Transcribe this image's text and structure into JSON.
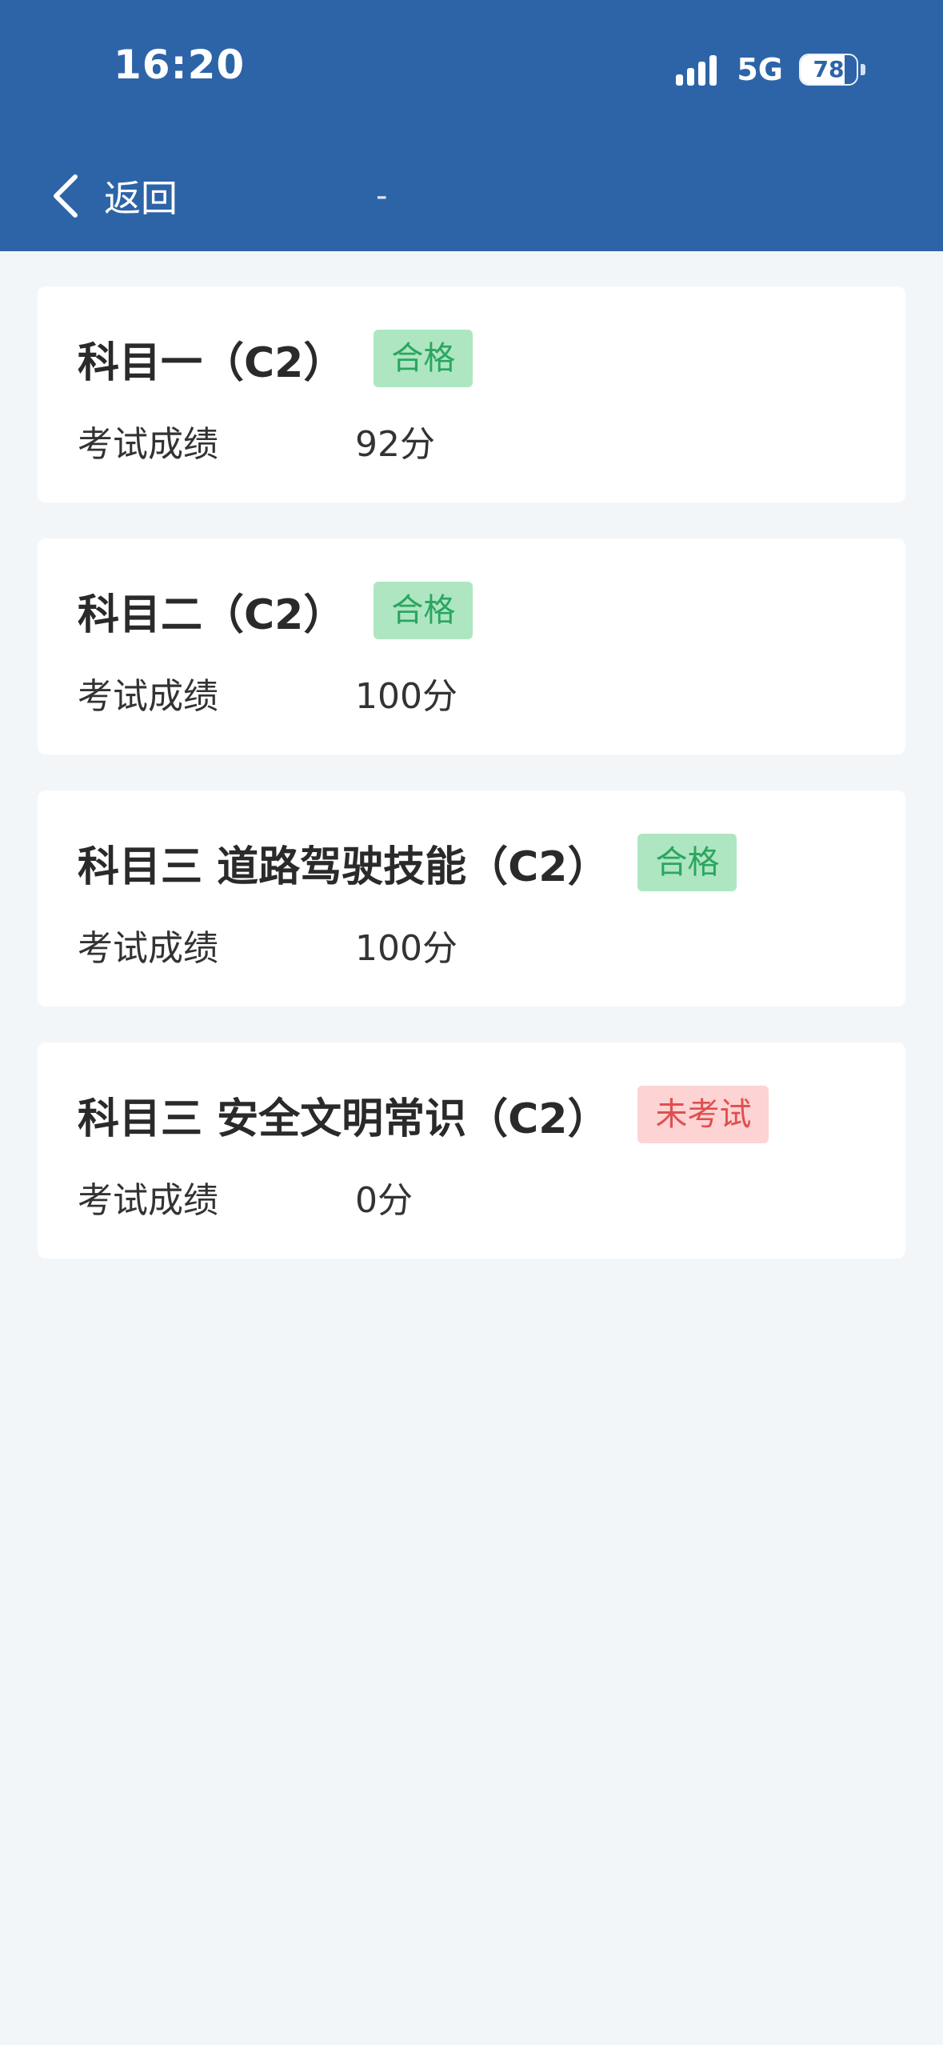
{
  "status_bar": {
    "time": "16:20",
    "network": "5G",
    "battery": "78",
    "battery_level": 0.78
  },
  "nav": {
    "back_label": "返回",
    "title": "-"
  },
  "results": [
    {
      "subject": "科目一（C2）",
      "status": "合格",
      "status_type": "pass",
      "score_label": "考试成绩",
      "score": "92分"
    },
    {
      "subject": "科目二（C2）",
      "status": "合格",
      "status_type": "pass",
      "score_label": "考试成绩",
      "score": "100分"
    },
    {
      "subject": "科目三 道路驾驶技能（C2）",
      "status": "合格",
      "status_type": "pass",
      "score_label": "考试成绩",
      "score": "100分"
    },
    {
      "subject": "科目三 安全文明常识（C2）",
      "status": "未考试",
      "status_type": "fail",
      "score_label": "考试成绩",
      "score": "0分"
    }
  ],
  "colors": {
    "header_bg": "#2d64a8",
    "page_bg": "#f3f6f8",
    "pass_bg": "#aee6c1",
    "pass_text": "#2aa660",
    "fail_bg": "#fdd3d3",
    "fail_text": "#e14f4f"
  }
}
